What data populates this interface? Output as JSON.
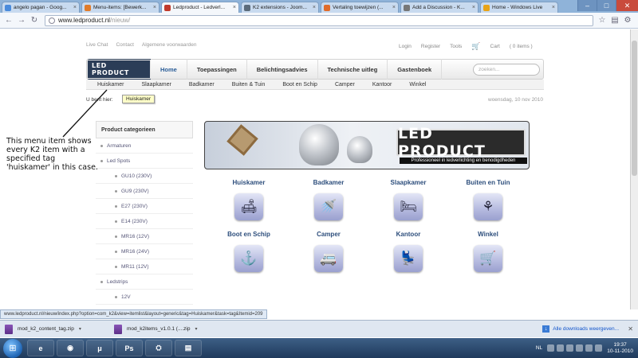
{
  "browser": {
    "tabs": [
      {
        "label": "angelo pagan - Goog...",
        "favicon_color": "#4a8bdc",
        "active": false
      },
      {
        "label": "Menu-items: [Bewerk...",
        "favicon_color": "#e07b2a",
        "active": false
      },
      {
        "label": "Ledproduct - Ledverl...",
        "favicon_color": "#c0392b",
        "active": true
      },
      {
        "label": "K2 extensions - Joom...",
        "favicon_color": "#5b6b7b",
        "active": false
      },
      {
        "label": "Vertaling toewijzen (...",
        "favicon_color": "#e06b2a",
        "active": false
      },
      {
        "label": "Add a Discussion - K...",
        "favicon_color": "#777777",
        "active": false
      },
      {
        "label": "Home - Windows Live",
        "favicon_color": "#e8a317",
        "active": false
      }
    ],
    "url_domain": "www.ledproduct.nl",
    "url_path": "/nieuw/",
    "status_url": "www.ledproduct.nl/nieuw/index.php?option=com_k2&view=itemlist&layout=generic&tag=Huiskamer&task=tag&Itemid=209"
  },
  "site": {
    "top_links": [
      "Live Chat",
      "Contact",
      "Algemene voorwaarden"
    ],
    "account_links": [
      "Login",
      "Register",
      "Tools"
    ],
    "cart": {
      "label": "Cart",
      "count": "( 0 items )"
    },
    "logo_text": "LED PRODUCT",
    "main_nav": [
      {
        "label": "Home",
        "active": true
      },
      {
        "label": "Toepassingen",
        "active": false
      },
      {
        "label": "Belichtingsadvies",
        "active": false
      },
      {
        "label": "Technische uitleg",
        "active": false
      },
      {
        "label": "Gastenboek",
        "active": false
      }
    ],
    "search_placeholder": "zoeken...",
    "sub_nav": [
      "Huiskamer",
      "Slaapkamer",
      "Badkamer",
      "Buiten & Tuin",
      "Boot en Schip",
      "Camper",
      "Kantoor",
      "Winkel"
    ],
    "breadcrumb_label": "U bent hier:",
    "tooltip": "Huiskamer",
    "date": "woensdag, 10 nov 2010"
  },
  "sidebar": {
    "title": "Product categorieen",
    "items": [
      {
        "label": "Armaturen",
        "level": 1
      },
      {
        "label": "Led Spots",
        "level": 1
      },
      {
        "label": "GU10 (230V)",
        "level": 2
      },
      {
        "label": "GU9 (230V)",
        "level": 2
      },
      {
        "label": "E27 (230V)",
        "level": 2
      },
      {
        "label": "E14 (230V)",
        "level": 2
      },
      {
        "label": "MR16 (12V)",
        "level": 2
      },
      {
        "label": "MR16 (24V)",
        "level": 2
      },
      {
        "label": "MR11 (12V)",
        "level": 2
      },
      {
        "label": "Ledstrips",
        "level": 1
      },
      {
        "label": "12V",
        "level": 2
      }
    ]
  },
  "banner": {
    "logo_text": "LED PRODUCT",
    "tagline": "Professioneel in ledverlichting en benodigdheden"
  },
  "categories": [
    {
      "label": "Huiskamer",
      "icon": "sofa-icon",
      "glyph": "🛋"
    },
    {
      "label": "Badkamer",
      "icon": "shower-icon",
      "glyph": "🚿"
    },
    {
      "label": "Slaapkamer",
      "icon": "bed-icon",
      "glyph": "🛏"
    },
    {
      "label": "Buiten en Tuin",
      "icon": "flower-icon",
      "glyph": "⚘"
    },
    {
      "label": "Boot en Schip",
      "icon": "anchor-icon",
      "glyph": "⚓"
    },
    {
      "label": "Camper",
      "icon": "camper-icon",
      "glyph": "🚐"
    },
    {
      "label": "Kantoor",
      "icon": "desk-worker-icon",
      "glyph": "💺"
    },
    {
      "label": "Winkel",
      "icon": "shopping-cart-icon",
      "glyph": "🛒"
    }
  ],
  "annotation": "This menu item shows every K2 item with a specified tag 'huiskamer' in this case.",
  "downloads": [
    {
      "file": "mod_k2_content_tag.zip"
    },
    {
      "file": "mod_k2items_v1.0.1 (....zip"
    }
  ],
  "all_downloads_label": "Alle downloads weergeven...",
  "taskbar": {
    "apps": [
      "e",
      "◉",
      "μ",
      "Ps",
      "⛭",
      "▤"
    ],
    "language": "NL",
    "time": "19:37",
    "date": "10-11-2010"
  }
}
